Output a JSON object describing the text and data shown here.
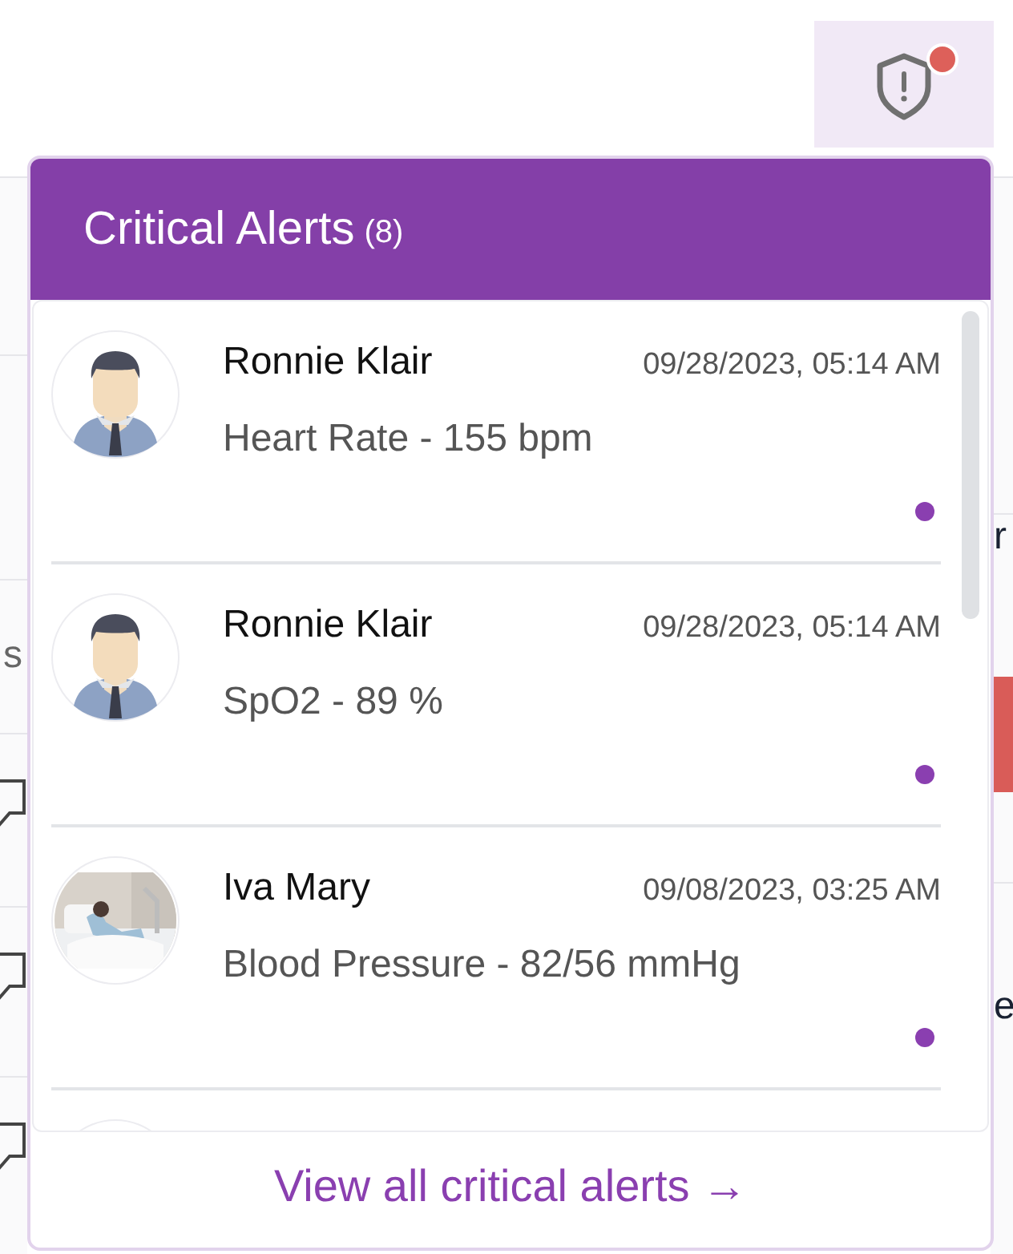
{
  "alert_button": {
    "badge": true
  },
  "panel": {
    "title": "Critical Alerts",
    "count": "(8)"
  },
  "alerts": [
    {
      "kind": "silhouette",
      "name": "Ronnie Klair",
      "time": "09/28/2023, 05:14 AM",
      "reading": "Heart Rate - 155 bpm",
      "unread": true
    },
    {
      "kind": "silhouette",
      "name": "Ronnie Klair",
      "time": "09/28/2023, 05:14 AM",
      "reading": "SpO2 - 89 %",
      "unread": true
    },
    {
      "kind": "picture",
      "name": "Iva Mary",
      "time": "09/08/2023, 03:25 AM",
      "reading": "Blood Pressure - 82/56 mmHg",
      "unread": true
    },
    {
      "kind": "blank"
    }
  ],
  "footer_link": "View all critical alerts →",
  "background": {
    "left_text": "s",
    "right_texts": [
      "r",
      "e"
    ]
  }
}
